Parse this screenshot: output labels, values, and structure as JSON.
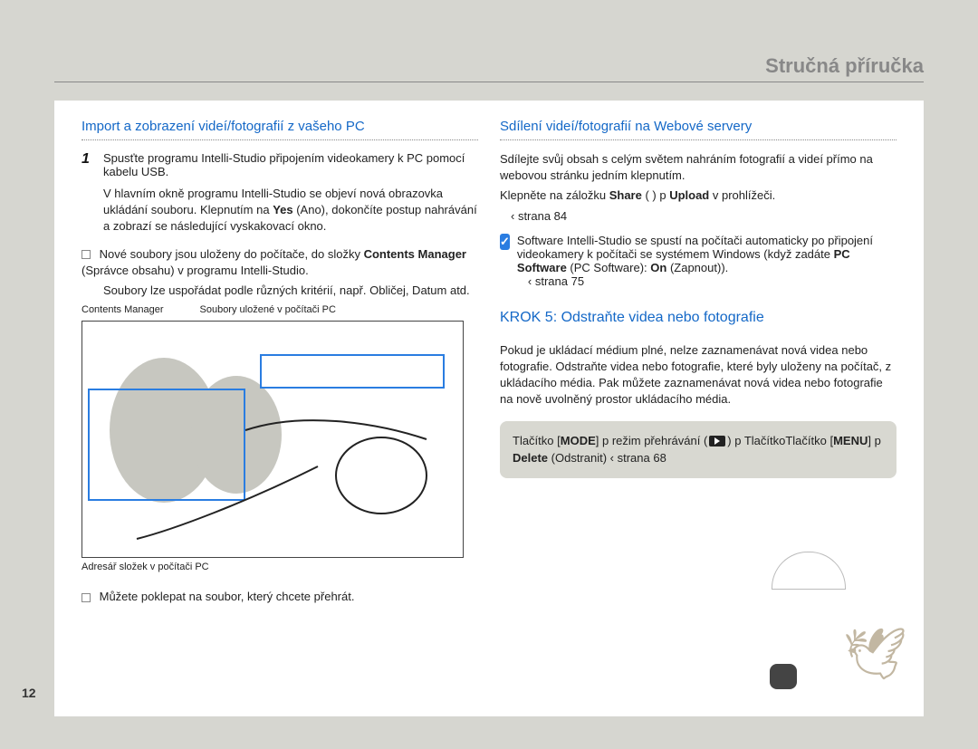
{
  "page_title": "Stručná příručka",
  "page_number": "12",
  "left": {
    "heading": "Import a zobrazení videí/fotografií z vašeho PC",
    "step1_num": "1",
    "step1_text": "Spusťte programu Intelli-Studio připojením videokamery k PC pomocí kabelu USB.",
    "step1_sub": "V hlavním okně programu Intelli-Studio se objeví nová obrazovka ukládání souboru. Klepnutím na ",
    "step1_yes": "Yes",
    "step1_yes_trans": " (Ano), dokončíte postup nahrávání a zobrazí se následující vyskakovací okno.",
    "step2_text": "Nové soubory jsou uloženy do počítače, do složky ",
    "step2_bold": "Contents Manager",
    "step2_trans": " (Správce obsahu) v programu Intelli-Studio.",
    "step2_sub": "Soubory lze uspořádat podle různých kritérií, např. Obličej, Datum atd.",
    "caption_left": "Contents Manager",
    "caption_right": "Soubory uložené v počítači PC",
    "caption_bottom": "Adresář složek v počítači PC",
    "step3_text": "Můžete poklepat na soubor, který chcete přehrát."
  },
  "right": {
    "heading1": "Sdílení videí/fotografií na Webové servery",
    "para1": "Sdílejte svůj obsah s celým světem nahráním fotografií a videí přímo na webovou stránku jedním klepnutím.",
    "para2_pre": "Klepněte na záložku ",
    "para2_share": "Share",
    "para2_mid": " (       ) p ",
    "para2_upload": "Upload",
    "para2_post": " v prohlížeči.",
    "para2_page": " ‹ strana 84",
    "note_text_pre": "Software Intelli-Studio se spustí na počítači automaticky po připojení videokamery k počítači se systémem Windows (když zadáte ",
    "note_bold1": "PC Software",
    "note_trans1": " (PC Software): ",
    "note_bold2": "On",
    "note_trans2": " (Zapnout)).",
    "note_page": " ‹ strana 75",
    "heading2": "KROK 5: Odstraňte videa nebo fotografie",
    "para3": "Pokud je ukládací médium plné, nelze zaznamenávat nová videa nebo fotografie. Odstraňte videa nebo fotografie, které byly uloženy na počítač, z ukládacího média. Pak můžete zaznamenávat nová videa nebo fotografie na nově uvolněný prostor ukládacího média.",
    "grey_pre": "Tlačítko [",
    "grey_mode": "MODE",
    "grey_mid1": "]  p režim přehrávání (",
    "grey_mid2": ")  p TlačítkoTlačítko [",
    "grey_menu": "MENU",
    "grey_mid3": "]  p ",
    "grey_delete": "Delete",
    "grey_trans": " (Odstranit)  ‹ strana 68"
  }
}
